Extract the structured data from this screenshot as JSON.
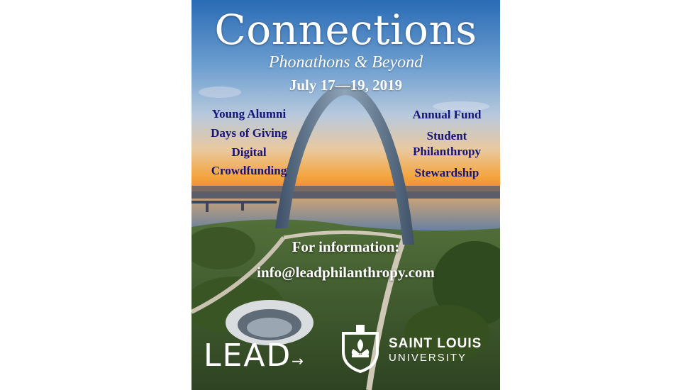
{
  "poster": {
    "title": "Connections",
    "subtitle": "Phonathons & Beyond",
    "dates": "July 17—19, 2019",
    "topics_left": [
      "Young Alumni",
      "Days of Giving",
      "Digital",
      "Crowdfunding"
    ],
    "topics_right": [
      "Annual Fund",
      "Student",
      "Philanthropy",
      "Stewardship"
    ],
    "info_label": "For information:",
    "info_email": "info@leadphilanthropy.com"
  },
  "logos": {
    "lead": "LEAD",
    "slu_name": "SAINT LOUIS",
    "slu_sub": "UNIVERSITY"
  },
  "colors": {
    "topic_text": "#16147a",
    "sky_top": "#2d6fb8",
    "sunset": "#f3a23c",
    "river": "#6f8fb0",
    "park": "#3d5a2c"
  }
}
